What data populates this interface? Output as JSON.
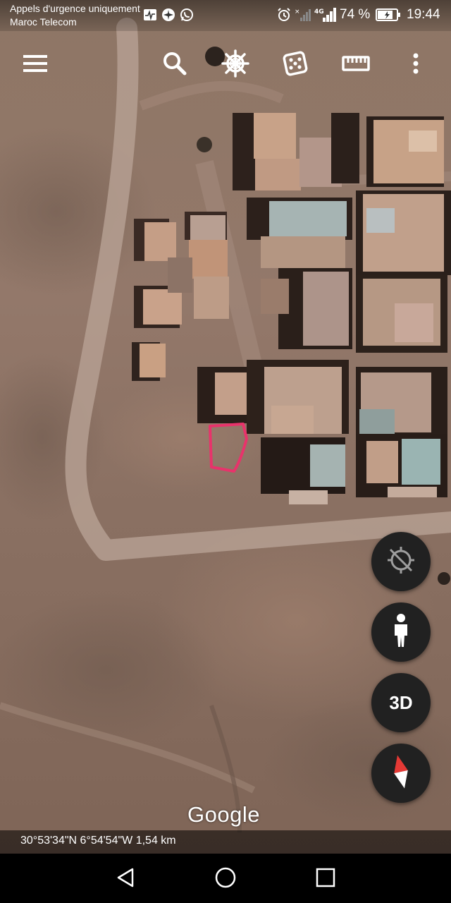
{
  "status_bar": {
    "carrier_line1": "Appels d'urgence uniquement",
    "carrier_line2": "Maroc Telecom",
    "battery_percent": "74 %",
    "time": "19:44",
    "network_label": "4G",
    "icons": [
      "activity-icon",
      "airplane-icon",
      "whatsapp-icon",
      "alarm-icon",
      "no-signal-icon",
      "signal-icon",
      "battery-icon"
    ]
  },
  "toolbar": {
    "icons": [
      "menu-icon",
      "search-icon",
      "voyager-wheel-icon",
      "feeling-lucky-dice-icon",
      "measure-ruler-icon",
      "more-vert-icon"
    ]
  },
  "map_controls": {
    "recenter_icon": "location-off-icon",
    "street_view_icon": "pegman-icon",
    "three_d_label": "3D",
    "compass_icon": "compass-icon"
  },
  "map": {
    "google_label": "Google",
    "coordinates": "30°53'34\"N 6°54'54\"W 1,54 km",
    "annotation_color": "#e8336b"
  },
  "nav_bar": {
    "icons": [
      "back-icon",
      "home-icon",
      "recents-icon"
    ]
  }
}
